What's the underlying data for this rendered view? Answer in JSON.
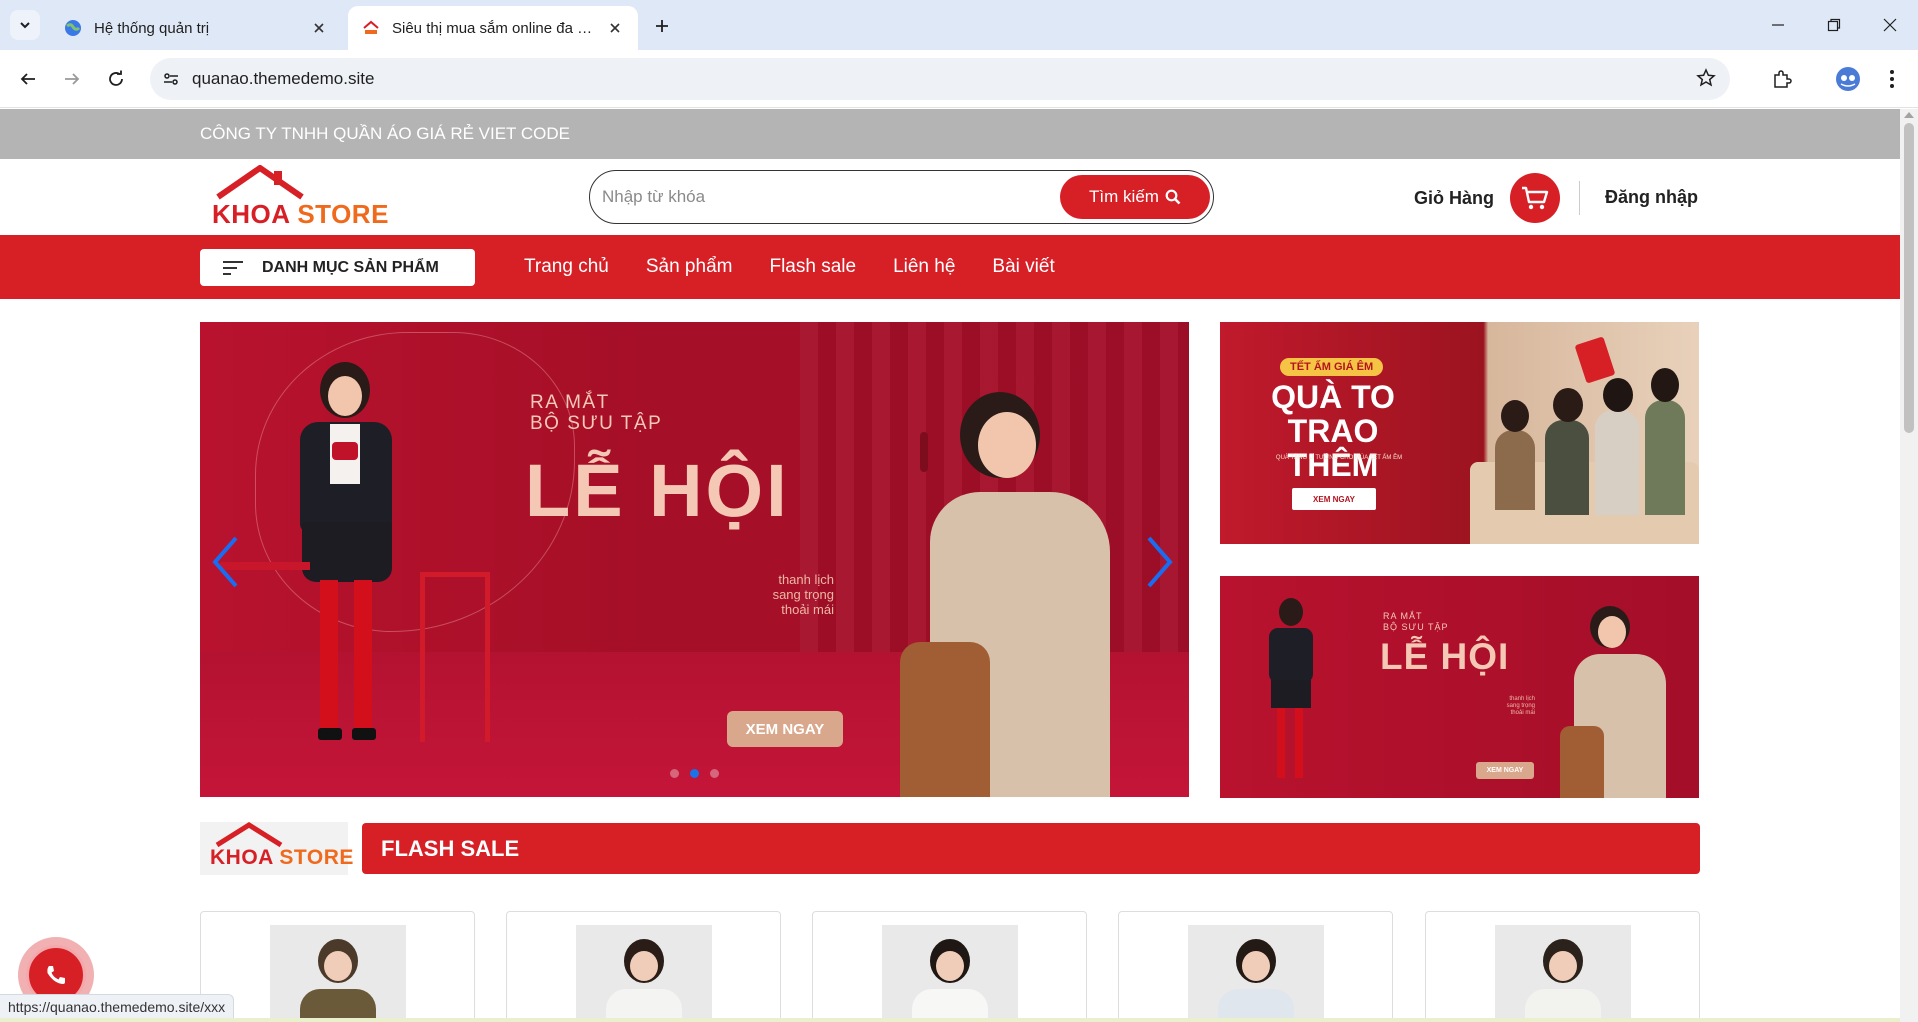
{
  "browser": {
    "tabs": [
      {
        "title": "Hệ thống quản trị",
        "active": false,
        "icon": "globe-favicon"
      },
      {
        "title": "Siêu thị mua sắm online đa dạng",
        "active": true,
        "icon": "store-favicon"
      }
    ],
    "url": "quanao.themedemo.site",
    "status_url": "https://quanao.themedemo.site/xxx"
  },
  "site": {
    "topbar_text": "CÔNG TY TNHH QUẦN ÁO GIÁ RẺ VIET CODE",
    "logo": {
      "word1": "KHOA",
      "word2": "STORE"
    },
    "search": {
      "placeholder": "Nhập từ khóa",
      "button_label": "Tìm kiếm"
    },
    "cart_label": "Giỏ Hàng",
    "login_label": "Đăng nhập",
    "category_button": "DANH MỤC SẢN PHẨM",
    "nav": [
      "Trang chủ",
      "Sản phẩm",
      "Flash sale",
      "Liên hệ",
      "Bài viết"
    ],
    "brand_red": "#d71f26"
  },
  "hero": {
    "small_line1": "RA MẮT",
    "small_line2": "BỘ SƯU TẬP",
    "title": "LỄ HỘI",
    "tagline1": "thanh lịch",
    "tagline2": "sang trọng",
    "tagline3": "thoải mái",
    "cta": "XEM NGAY",
    "dots": 3,
    "active_dot": 2
  },
  "side_banner_1": {
    "tag": "TẾT ẤM GIÁ ÊM",
    "title_line1": "QUÀ TO",
    "title_line2": "TRAO THÊM",
    "subtitle": "QUÀ TẶNG LÍ TƯỞNG CHO MÙA TẾT ẤM ÊM",
    "cta": "XEM NGAY"
  },
  "side_banner_2": {
    "small_line1": "RA MẮT",
    "small_line2": "BỘ SƯU TẬP",
    "title": "LỄ HỘI",
    "tagline1": "thanh lịch",
    "tagline2": "sang trọng",
    "tagline3": "thoải mái",
    "cta": "XEM NGAY"
  },
  "flash_sale": {
    "title": "FLASH SALE",
    "products": [
      {
        "hair": "#4b3a2a",
        "outfit": "#6b5a3a"
      },
      {
        "hair": "#2a1c16",
        "outfit": "#f4f4f2"
      },
      {
        "hair": "#1e1714",
        "outfit": "#f7f7f5"
      },
      {
        "hair": "#241a15",
        "outfit": "#dfe6ee"
      },
      {
        "hair": "#2b221c",
        "outfit": "#f2f2ef"
      }
    ]
  }
}
